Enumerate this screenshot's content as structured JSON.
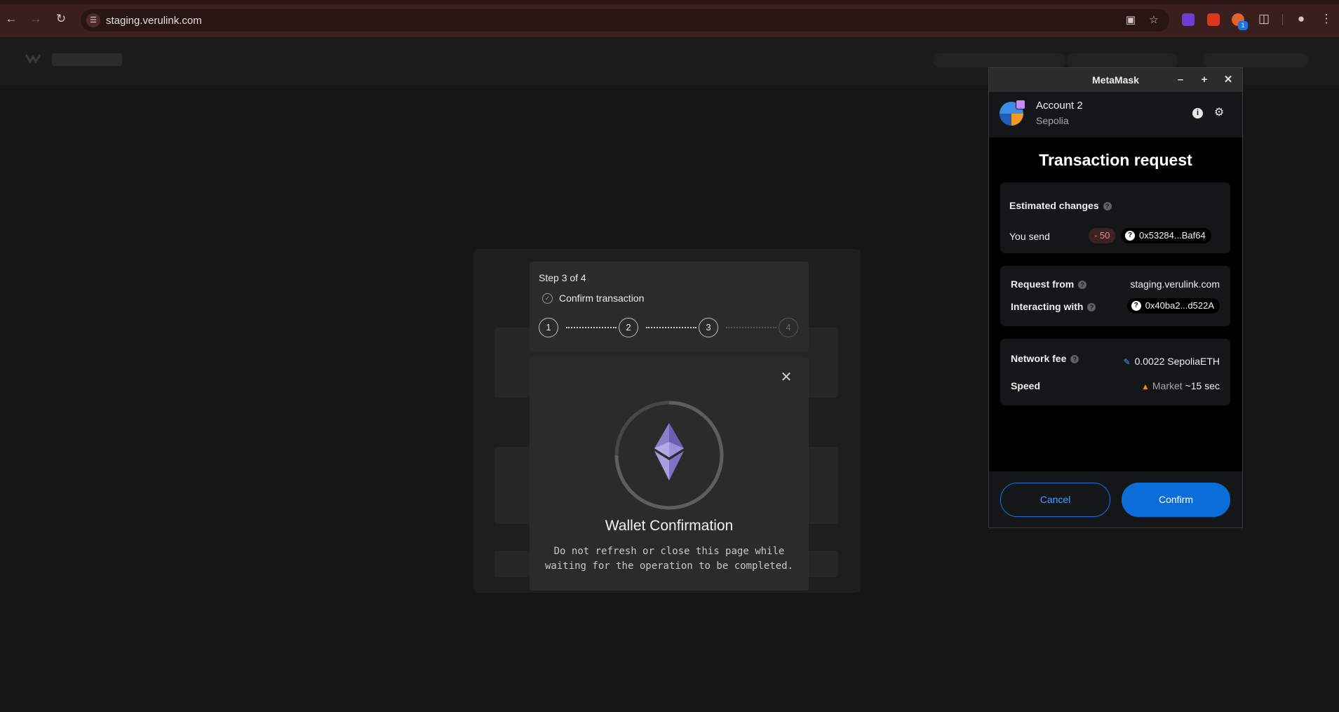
{
  "browser": {
    "url": "staging.verulink.com",
    "extension_badge": "1"
  },
  "step_panel": {
    "title": "Step 3 of 4",
    "subtitle": "Confirm transaction",
    "steps": [
      "1",
      "2",
      "3",
      "4"
    ],
    "current_step": 3,
    "total_steps": 4
  },
  "wallet_modal": {
    "title": "Wallet Confirmation",
    "description": "Do not refresh or close this page while waiting for the operation to be completed."
  },
  "metamask": {
    "window_title": "MetaMask",
    "account": {
      "name": "Account 2",
      "network": "Sepolia"
    },
    "heading": "Transaction request",
    "estimated_changes": {
      "label": "Estimated changes",
      "send_label": "You send",
      "amount": "- 50",
      "token_address": "0x53284...Baf64"
    },
    "request": {
      "from_label": "Request from",
      "from_value": "staging.verulink.com",
      "interacting_label": "Interacting with",
      "interacting_value": "0x40ba2...d522A"
    },
    "fee": {
      "label": "Network fee",
      "value": "0.0022 SepoliaETH",
      "speed_label": "Speed",
      "speed_market": "Market",
      "speed_time": "~15 sec"
    },
    "buttons": {
      "cancel": "Cancel",
      "confirm": "Confirm"
    }
  },
  "colors": {
    "accent": "#0b6ed8",
    "link": "#43a2ff",
    "send_amount": "#e88a8a",
    "chrome_bar": "#3a1f1f"
  }
}
